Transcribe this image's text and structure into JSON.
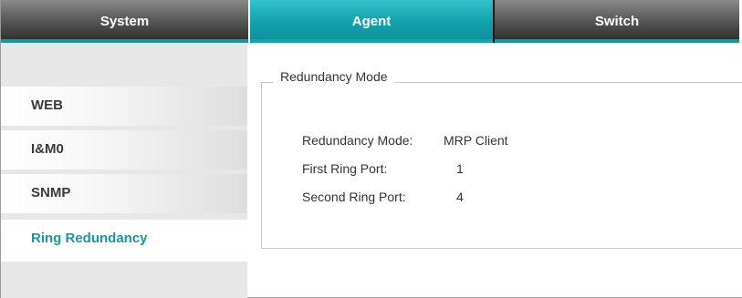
{
  "tabs": [
    {
      "label": "System"
    },
    {
      "label": "Agent"
    },
    {
      "label": "Switch"
    }
  ],
  "sidebar": {
    "items": [
      {
        "label": "WEB"
      },
      {
        "label": "I&M0"
      },
      {
        "label": "SNMP"
      },
      {
        "label": "Ring Redundancy"
      }
    ]
  },
  "panel": {
    "legend": "Redundancy Mode",
    "rows": [
      {
        "label": "Redundancy Mode:",
        "value": "MRP Client"
      },
      {
        "label": "First Ring Port:",
        "value": "1"
      },
      {
        "label": "Second Ring Port:",
        "value": "4"
      }
    ]
  },
  "colors": {
    "accent": "#14a3ae",
    "active_text": "#1897a3",
    "tab_dark": "#3a3a3a"
  }
}
